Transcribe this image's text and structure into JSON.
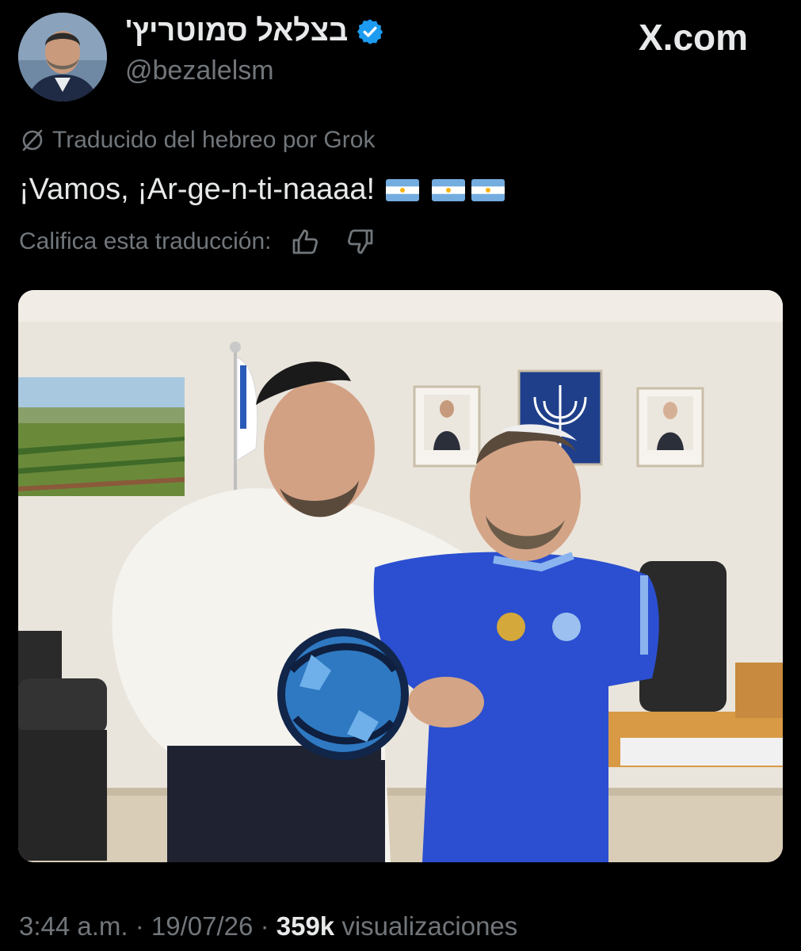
{
  "author": {
    "display_name": "בצלאל סמוטריץ'",
    "handle": "@bezalelsm",
    "verified": true,
    "verified_color": "#1d9bf0"
  },
  "brand": {
    "label": "X.com"
  },
  "translation": {
    "notice": "Traducido del hebreo por Grok",
    "icon": "translation-slash-icon"
  },
  "tweet": {
    "text": "¡Vamos, ¡Ar-ge-n-ti-naaaa!",
    "flags": [
      "argentina-flag-icon",
      "argentina-flag-icon",
      "argentina-flag-icon"
    ]
  },
  "rating": {
    "label": "Califica esta traducción:",
    "up_icon": "thumbs-up-icon",
    "down_icon": "thumbs-down-icon"
  },
  "media": {
    "type": "photo"
  },
  "footer": {
    "time": "3:44 a.m.",
    "separator": "·",
    "date": "19/07/26",
    "views_count": "359k",
    "views_label": "visualizaciones"
  },
  "colors": {
    "background": "#000000",
    "primary_text": "#e7e9ea",
    "secondary_text": "#71767b",
    "flag_blue": "#74acdf"
  }
}
